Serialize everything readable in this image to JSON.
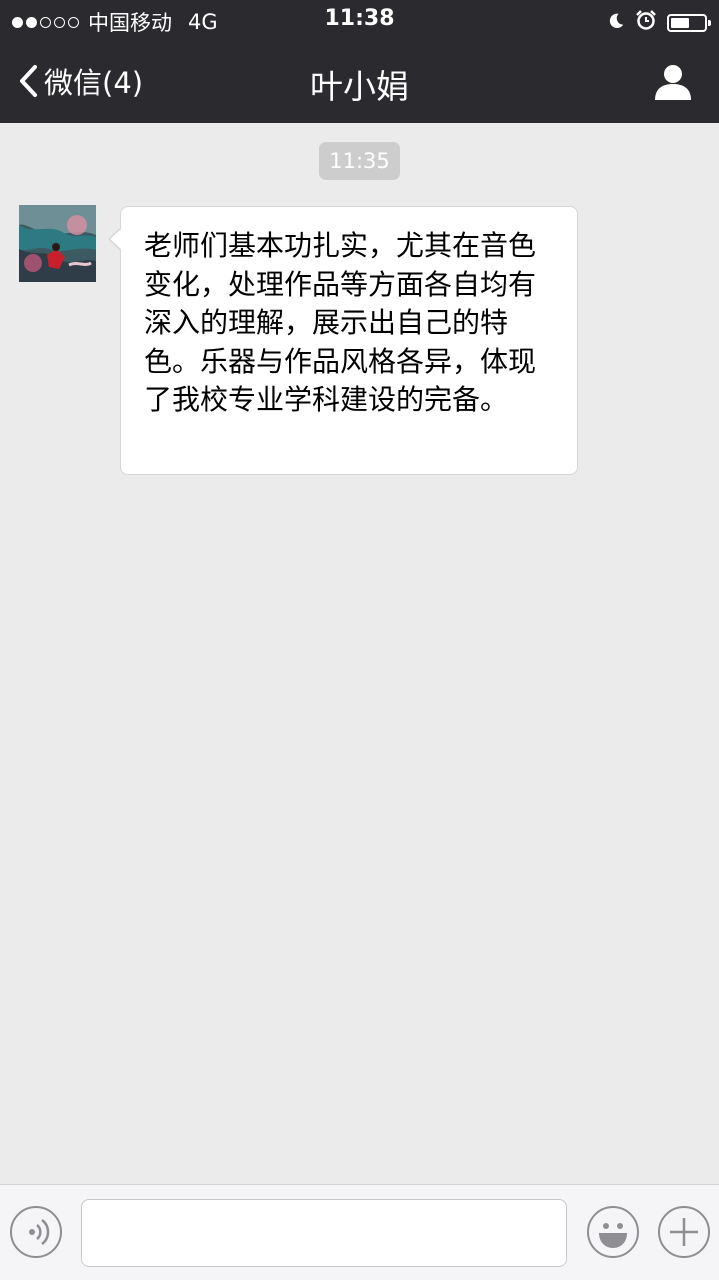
{
  "status_bar": {
    "carrier": "中国移动",
    "network": "4G",
    "time": "11:38",
    "signal_bars_filled": 2,
    "signal_bars_total": 5,
    "battery_level": 0.55
  },
  "nav": {
    "back_label": "微信(4)",
    "title": "叶小娟"
  },
  "chat": {
    "timestamp": "11:35",
    "messages": [
      {
        "sender": "contact",
        "text": "老师们基本功扎实，尤其在音色变化，处理作品等方面各自均有深入的理解，展示出自己的特色。乐器与作品风格各异，体现了我校专业学科建设的完备。"
      }
    ]
  },
  "input_bar": {
    "placeholder": ""
  },
  "icons": {
    "back": "chevron-left-icon",
    "profile": "person-icon",
    "voice": "voice-icon",
    "emoji": "emoji-icon",
    "plus": "plus-icon",
    "moon": "moon-icon",
    "alarm": "alarm-clock-icon"
  },
  "colors": {
    "top_bar": "#2b2b2f",
    "chat_background": "#ebebeb",
    "bubble": "#ffffff",
    "time_chip": "#cdcdcd",
    "bottom_bar": "#f5f5f7"
  }
}
